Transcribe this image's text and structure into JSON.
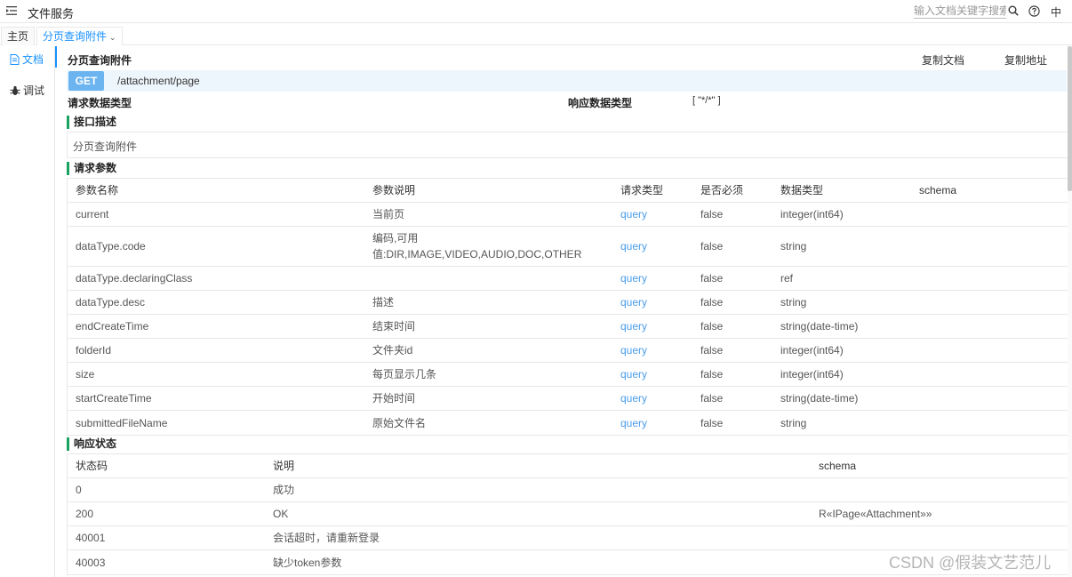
{
  "topbar": {
    "title": "文件服务",
    "search_placeholder": "输入文档关键字搜索",
    "lang": "中",
    "icons": [
      "menu-toggle-icon",
      "search-icon",
      "help-icon"
    ]
  },
  "tabs": [
    {
      "label": "主页"
    },
    {
      "label": "分页查询附件"
    }
  ],
  "leftnav": [
    {
      "label": "文档",
      "icon": "document-icon"
    },
    {
      "label": "调试",
      "icon": "bug-icon"
    }
  ],
  "api": {
    "title": "分页查询附件",
    "copy_doc": "复制文档",
    "copy_address": "复制地址",
    "method": "GET",
    "path": "/attachment/page",
    "request_type_label": "请求数据类型",
    "response_type_label": "响应数据类型",
    "response_type_value": "[ \"*/*\" ]"
  },
  "description": {
    "heading": "接口描述",
    "text": "分页查询附件"
  },
  "params": {
    "heading": "请求参数",
    "columns": [
      "参数名称",
      "参数说明",
      "请求类型",
      "是否必须",
      "数据类型",
      "schema"
    ],
    "rows": [
      [
        "current",
        "当前页",
        "query",
        "false",
        "integer(int64)",
        ""
      ],
      [
        "dataType.code",
        "编码,可用值:DIR,IMAGE,VIDEO,AUDIO,DOC,OTHER",
        "query",
        "false",
        "string",
        ""
      ],
      [
        "dataType.declaringClass",
        "",
        "query",
        "false",
        "ref",
        ""
      ],
      [
        "dataType.desc",
        "描述",
        "query",
        "false",
        "string",
        ""
      ],
      [
        "endCreateTime",
        "结束时间",
        "query",
        "false",
        "string(date-time)",
        ""
      ],
      [
        "folderId",
        "文件夹id",
        "query",
        "false",
        "integer(int64)",
        ""
      ],
      [
        "size",
        "每页显示几条",
        "query",
        "false",
        "integer(int64)",
        ""
      ],
      [
        "startCreateTime",
        "开始时间",
        "query",
        "false",
        "string(date-time)",
        ""
      ],
      [
        "submittedFileName",
        "原始文件名",
        "query",
        "false",
        "string",
        ""
      ]
    ]
  },
  "responses": {
    "heading": "响应状态",
    "columns": [
      "状态码",
      "说明",
      "schema"
    ],
    "rows": [
      [
        "0",
        "成功",
        ""
      ],
      [
        "200",
        "OK",
        "R«IPage«Attachment»»"
      ],
      [
        "40001",
        "会话超时，请重新登录",
        ""
      ],
      [
        "40003",
        "缺少token参数",
        ""
      ]
    ]
  },
  "watermark": "CSDN @假装文艺范儿",
  "colors": {
    "accent": "#1890ff",
    "method_badge": "#6bb4f0",
    "section_marker": "#1aa260",
    "query_link": "#4a9be8"
  }
}
